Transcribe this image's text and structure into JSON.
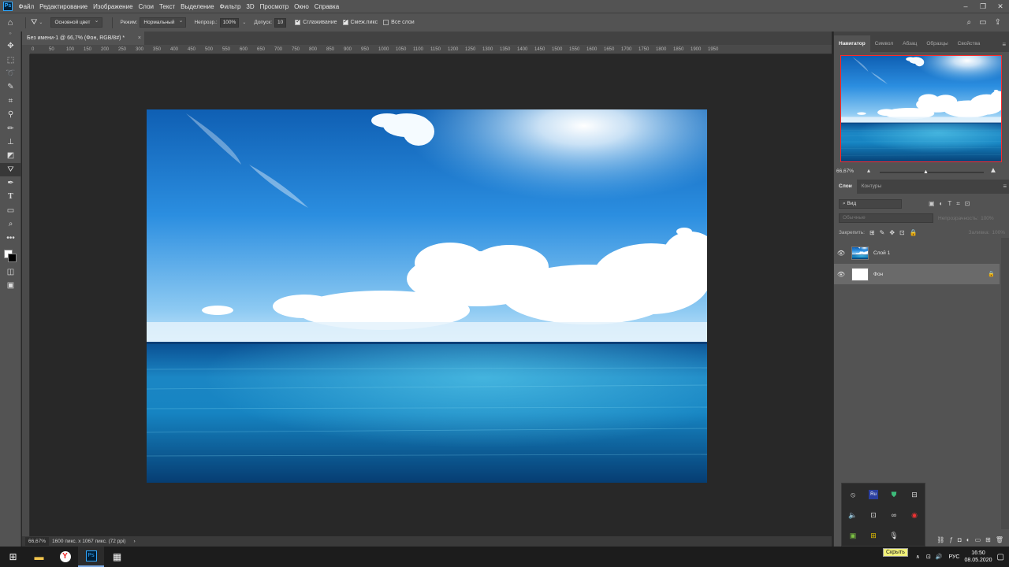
{
  "app": {
    "logo": "Ps"
  },
  "menu": [
    "Файл",
    "Редактирование",
    "Изображение",
    "Слои",
    "Текст",
    "Выделение",
    "Фильтр",
    "3D",
    "Просмотр",
    "Окно",
    "Справка"
  ],
  "options": {
    "brush_mode_select": "Основной цвет",
    "mode_label": "Режим:",
    "mode_value": "Нормальный",
    "opacity_label": "Непрозр.:",
    "opacity_value": "100%",
    "tolerance_label": "Допуск:",
    "tolerance_value": "10",
    "antialias_label": "Сглаживание",
    "contiguous_label": "Смеж.пикс",
    "all_layers_label": "Все слои"
  },
  "document": {
    "tab_title": "Без имени-1 @ 66,7% (Фон, RGB/8#) *",
    "tab_close": "×"
  },
  "ruler": {
    "h_ticks": [
      "0",
      "50",
      "100",
      "150",
      "200",
      "250",
      "300",
      "350",
      "400",
      "450",
      "500",
      "550",
      "600",
      "650",
      "700",
      "750",
      "800",
      "850",
      "900",
      "950",
      "1000",
      "1050",
      "1100",
      "1150",
      "1200",
      "1250",
      "1300",
      "1350",
      "1400",
      "1450",
      "1500",
      "1550",
      "1600",
      "1650",
      "1700",
      "1750",
      "1800",
      "1850",
      "1900",
      "1950"
    ]
  },
  "status": {
    "zoom": "66,67%",
    "doc_info": "1600 пикс. x 1067 пикс. (72 ppi)",
    "arrow": "›"
  },
  "navigator": {
    "tabs": [
      "Навигатор",
      "Символ",
      "Абзац",
      "Образцы",
      "Свойства"
    ],
    "zoom": "66,67%"
  },
  "layers_panel": {
    "tabs": [
      "Слои",
      "Контуры"
    ],
    "filter_value": "Вид",
    "blend_mode": "Обычные",
    "opacity_label": "Непрозрачность:",
    "opacity_value": "100%",
    "lock_label": "Закрепить:",
    "fill_label": "Заливка:",
    "fill_value": "100%",
    "layers": [
      {
        "name": "Слой 1"
      },
      {
        "name": "Фон"
      }
    ]
  },
  "taskbar": {
    "lang": "РУС",
    "time": "16:50",
    "date": "08.05.2020",
    "tray_tooltip": "Скрыть"
  },
  "colors": {
    "panel_bg": "#535353",
    "workspace_bg": "#282828",
    "nav_frame": "#ff2a2a"
  }
}
